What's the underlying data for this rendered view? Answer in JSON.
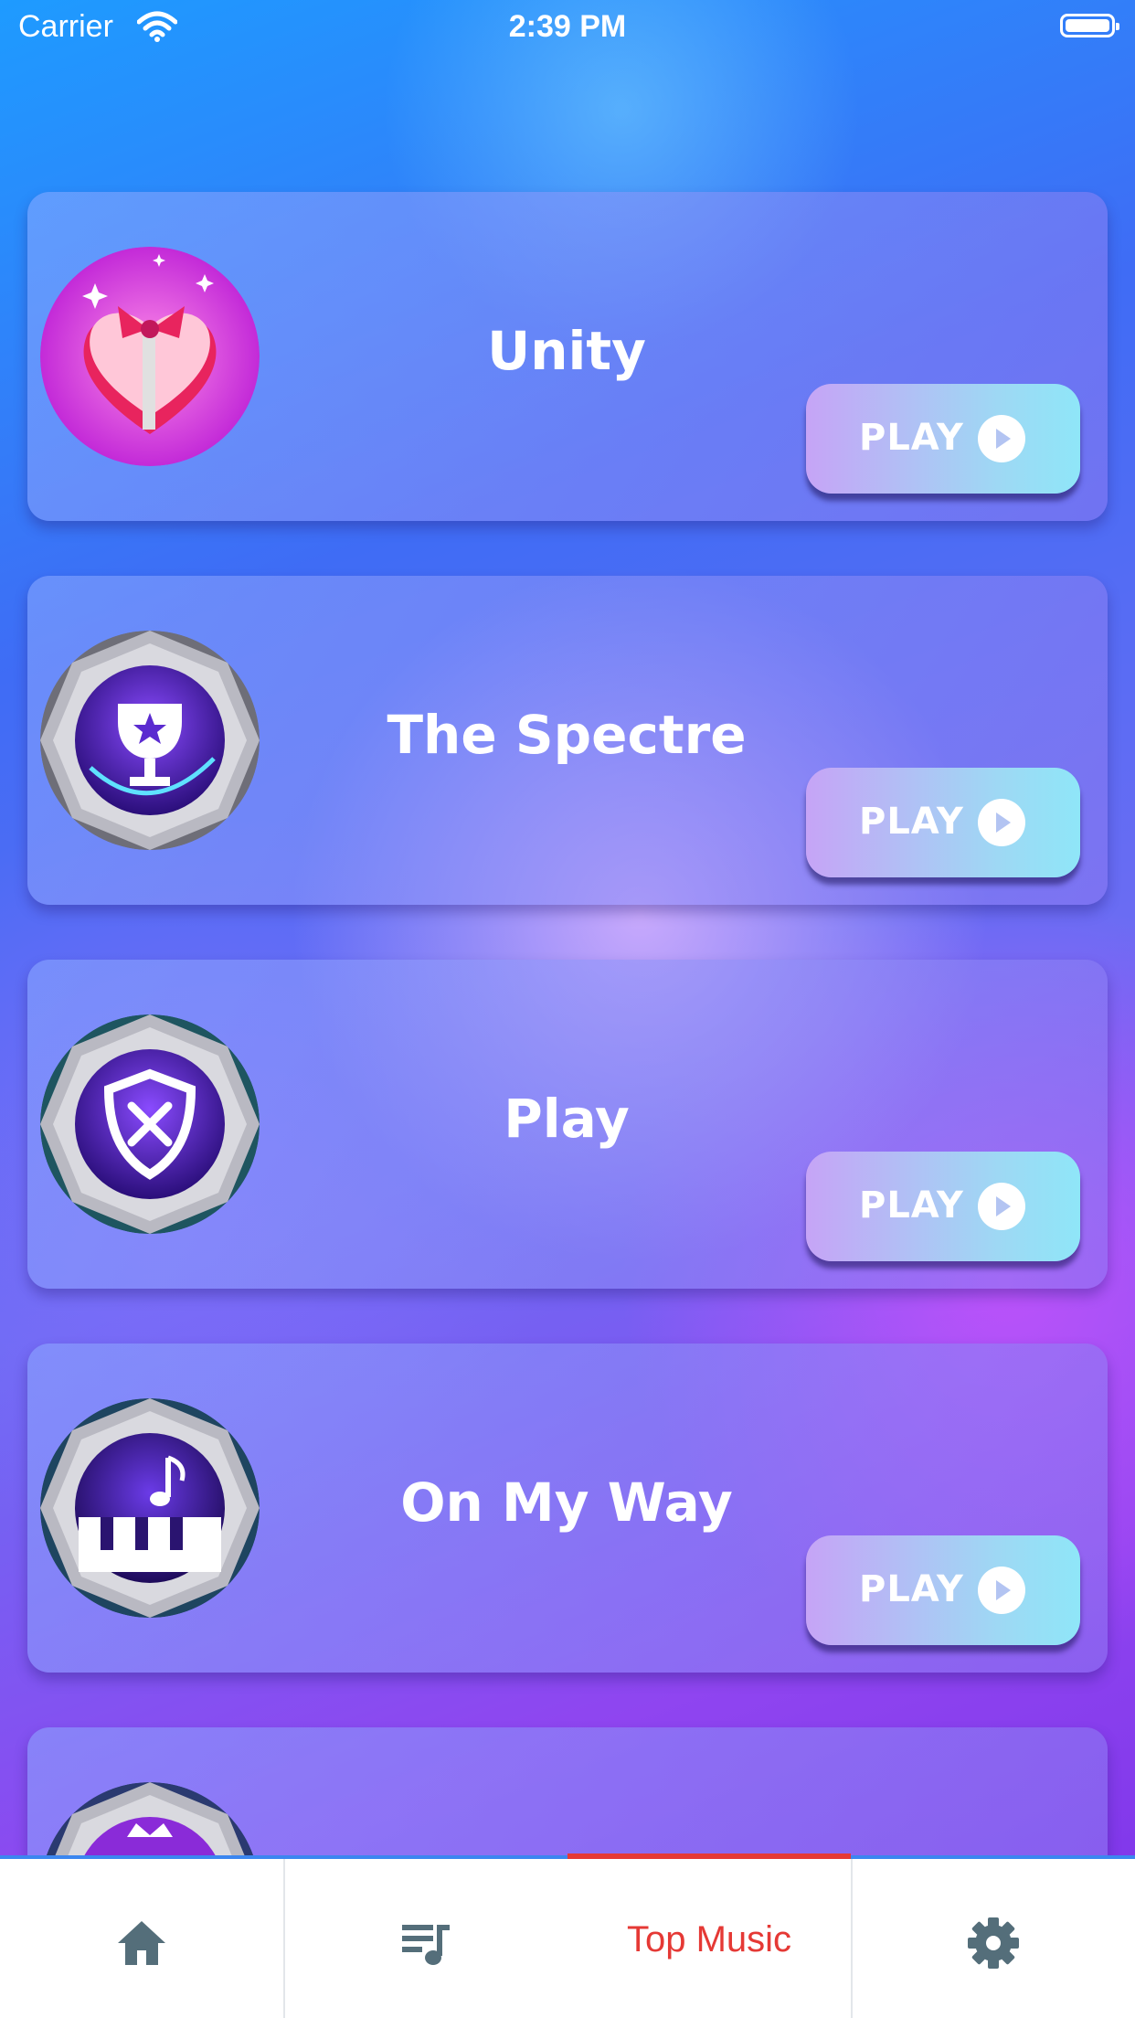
{
  "status_bar": {
    "carrier": "Carrier",
    "time": "2:39 PM"
  },
  "songs": [
    {
      "title": "Unity",
      "play_label": "PLAY",
      "icon": "heart-gift-icon"
    },
    {
      "title": "The Spectre",
      "play_label": "PLAY",
      "icon": "trophy-badge-icon"
    },
    {
      "title": "Play",
      "play_label": "PLAY",
      "icon": "shield-swords-badge-icon"
    },
    {
      "title": "On My Way",
      "play_label": "PLAY",
      "icon": "piano-note-badge-icon"
    },
    {
      "title": "",
      "play_label": "",
      "icon": "crown-badge-icon"
    }
  ],
  "tab_bar": {
    "tabs": [
      {
        "icon": "home-icon",
        "label": ""
      },
      {
        "icon": "playlist-icon",
        "label": ""
      },
      {
        "icon": "",
        "label": "Top Music",
        "selected": true
      },
      {
        "icon": "gear-icon",
        "label": ""
      }
    ],
    "accent_color": "#E53935",
    "icon_color": "#546E7A"
  }
}
